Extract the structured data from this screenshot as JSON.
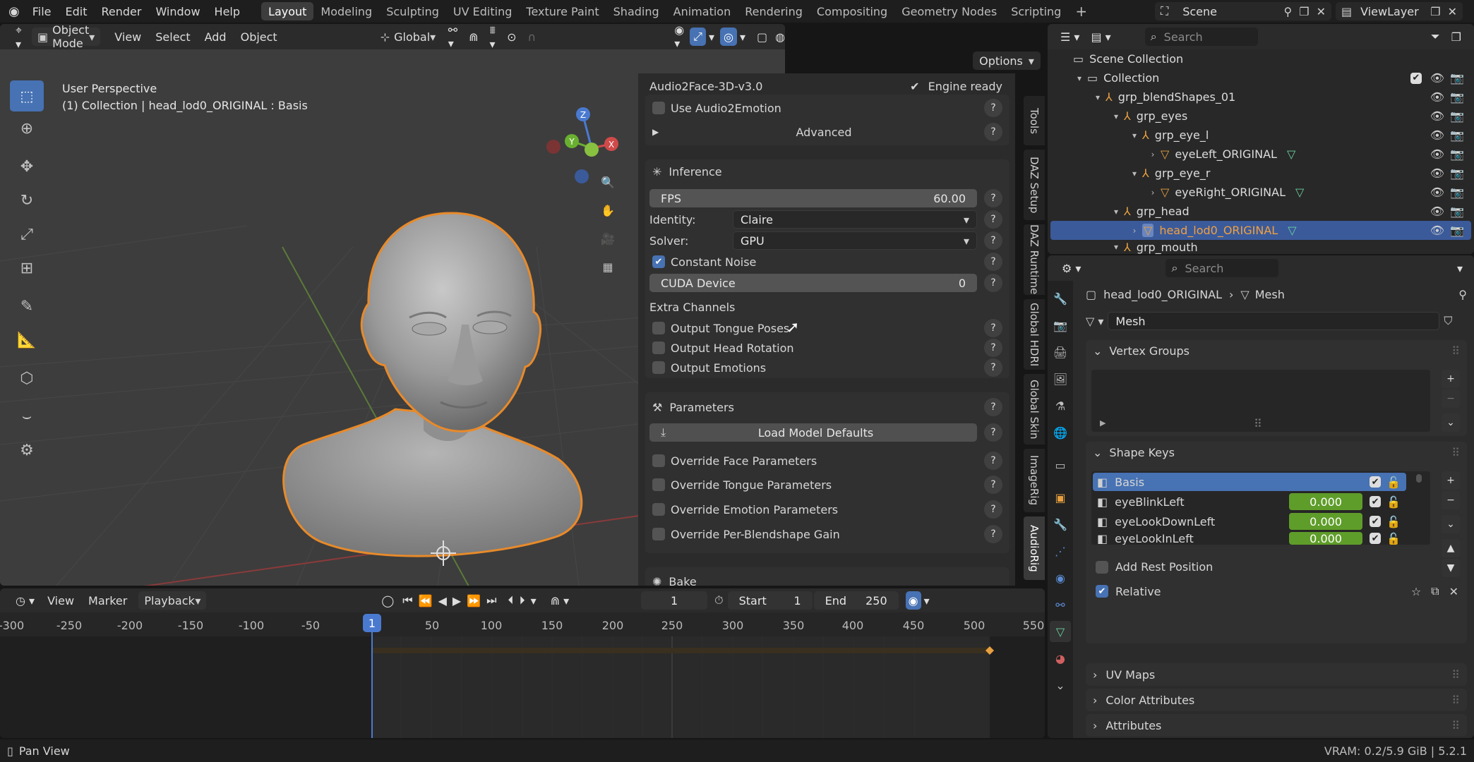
{
  "topbar": {
    "menus": [
      "File",
      "Edit",
      "Render",
      "Window",
      "Help"
    ],
    "workspaces": [
      "Layout",
      "Modeling",
      "Sculpting",
      "UV Editing",
      "Texture Paint",
      "Shading",
      "Animation",
      "Rendering",
      "Compositing",
      "Geometry Nodes",
      "Scripting"
    ],
    "active_workspace": "Layout",
    "add_tab": "+",
    "scene": "Scene",
    "view_layer": "ViewLayer"
  },
  "viewport_header": {
    "mode": "Object Mode",
    "menus": [
      "View",
      "Select",
      "Add",
      "Object"
    ],
    "transform": "Global",
    "options": "Options"
  },
  "viewport": {
    "overlay_line1": "User Perspective",
    "overlay_line2": "(1) Collection | head_lod0_ORIGINAL : Basis",
    "gizmo_x": "X",
    "gizmo_y": "Y",
    "gizmo_z": "Z"
  },
  "sidebar_tabs": [
    "Tools",
    "DAZ Setup",
    "DAZ Runtime",
    "Global HDRI",
    "Global Skin",
    "ImageRig",
    "AudioRig"
  ],
  "audiorig": {
    "model": "Audio2Face-3D-v3.0",
    "engine_status": "Engine ready",
    "use_emotion": "Use Audio2Emotion",
    "advanced": "Advanced",
    "inference": {
      "title": "Inference",
      "fps_label": "FPS",
      "fps_value": "60.00",
      "identity_label": "Identity:",
      "identity_value": "Claire",
      "solver_label": "Solver:",
      "solver_value": "GPU",
      "constant_noise": "Constant Noise",
      "cuda_label": "CUDA Device",
      "cuda_value": "0",
      "extra_channels": "Extra Channels",
      "tongue": "Output Tongue Poses",
      "head_rot": "Output Head Rotation",
      "emotions": "Output Emotions"
    },
    "parameters": {
      "title": "Parameters",
      "load_defaults": "Load Model Defaults",
      "face": "Override Face Parameters",
      "tongue": "Override Tongue Parameters",
      "emotion": "Override Emotion Parameters",
      "gain": "Override Per-Blendshape Gain"
    },
    "bake": "Bake"
  },
  "timeline": {
    "menus": [
      "View",
      "Marker",
      "Playback"
    ],
    "current_frame": "1",
    "start_label": "Start",
    "start_value": "1",
    "end_label": "End",
    "end_value": "250",
    "ruler": [
      "-300",
      "-250",
      "-200",
      "-150",
      "-100",
      "-50",
      "1",
      "50",
      "100",
      "150",
      "200",
      "250",
      "300",
      "350",
      "400",
      "450",
      "500",
      "550"
    ]
  },
  "outliner": {
    "search_placeholder": "Search",
    "rows": [
      {
        "label": "Scene Collection",
        "indent": 0
      },
      {
        "label": "Collection",
        "indent": 1
      },
      {
        "label": "grp_blendShapes_01",
        "indent": 2
      },
      {
        "label": "grp_eyes",
        "indent": 3
      },
      {
        "label": "grp_eye_l",
        "indent": 4
      },
      {
        "label": "eyeLeft_ORIGINAL",
        "indent": 5
      },
      {
        "label": "grp_eye_r",
        "indent": 4
      },
      {
        "label": "eyeRight_ORIGINAL",
        "indent": 5
      },
      {
        "label": "grp_head",
        "indent": 3
      },
      {
        "label": "head_lod0_ORIGINAL",
        "indent": 4
      },
      {
        "label": "grp_mouth",
        "indent": 3
      }
    ]
  },
  "properties": {
    "search_placeholder": "Search",
    "breadcrumb_object": "head_lod0_ORIGINAL",
    "breadcrumb_data": "Mesh",
    "mesh_name": "Mesh",
    "vertex_groups": "Vertex Groups",
    "shape_keys": "Shape Keys",
    "keys": [
      {
        "name": "Basis",
        "value": ""
      },
      {
        "name": "eyeBlinkLeft",
        "value": "0.000"
      },
      {
        "name": "eyeLookDownLeft",
        "value": "0.000"
      },
      {
        "name": "eyeLookInLeft",
        "value": "0.000"
      }
    ],
    "add_rest": "Add Rest Position",
    "relative": "Relative",
    "uv_maps": "UV Maps",
    "color_attributes": "Color Attributes",
    "attributes": "Attributes"
  },
  "statusbar": {
    "left": "Pan View",
    "right": "VRAM: 0.2/5.9 GiB | 5.2.1"
  }
}
